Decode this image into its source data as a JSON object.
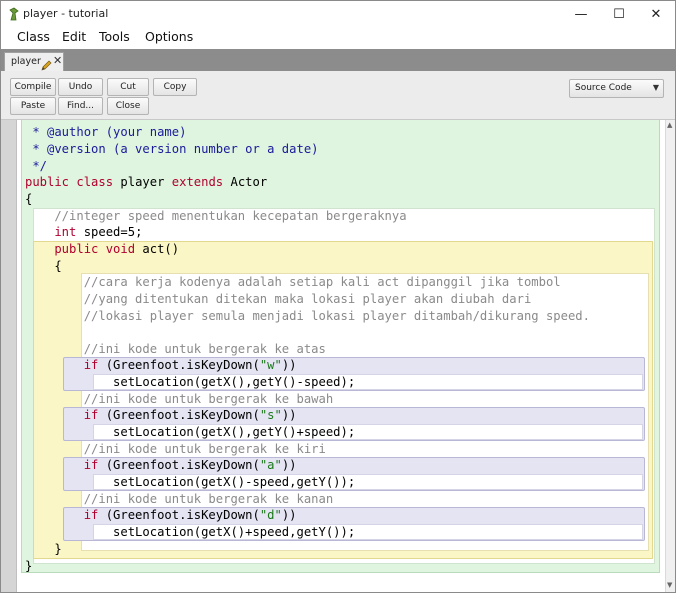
{
  "window": {
    "title": "player - tutorial",
    "minimize_icon": "—",
    "maximize_icon": "☐",
    "close_icon": "✕"
  },
  "menu": [
    "Class",
    "Edit",
    "Tools",
    "Options"
  ],
  "tab": {
    "label": "player",
    "close": "✕"
  },
  "toolbar": {
    "buttons": [
      "Compile",
      "Undo",
      "Cut",
      "Copy",
      "Paste",
      "Find...",
      "Close"
    ],
    "view_select": "Source Code"
  },
  "code": {
    "doc_author": " * @author (your name)",
    "doc_version": " * @version (a version number or a date)",
    "doc_end": " */",
    "class_kw1": "public class",
    "class_name": " player ",
    "class_kw2": "extends",
    "class_parent": " Actor",
    "open_brace": "{",
    "comment_speed": "    //integer speed menentukan kecepatan bergeraknya",
    "field_type": "    int",
    "field_rest": " speed=5;",
    "method_kw": "    public void",
    "method_name": " act()",
    "method_open": "    {",
    "comment_1": "        //cara kerja kodenya adalah setiap kali act dipanggil jika tombol",
    "comment_2": "        //yang ditentukan ditekan maka lokasi player akan diubah dari",
    "comment_3": "        //lokasi player semula menjadi lokasi player ditambah/dikurang speed.",
    "comment_up": "        //ini kode untuk bergerak ke atas",
    "comment_down": "        //ini kode untuk bergerak ke bawah",
    "comment_left": "        //ini kode untuk bergerak ke kiri",
    "comment_right": "        //ini kode untuk bergerak ke kanan",
    "if_kw": "        if",
    "if_pre": " (Greenfoot.isKeyDown(",
    "if_post": "))",
    "key_w": "\"w\"",
    "key_s": "\"s\"",
    "key_a": "\"a\"",
    "key_d": "\"d\"",
    "set_up": "            setLocation(getX(),getY()-speed);",
    "set_down": "            setLocation(getX(),getY()+speed);",
    "set_left": "            setLocation(getX()-speed,getY());",
    "set_right": "            setLocation(getX()+speed,getY());",
    "method_close": "    }",
    "close_brace": "}"
  }
}
